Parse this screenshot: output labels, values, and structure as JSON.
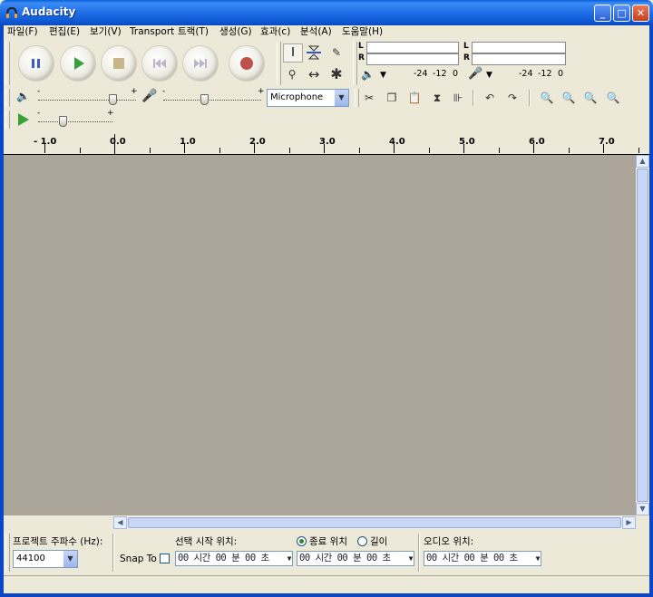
{
  "window": {
    "title": "Audacity"
  },
  "menu": [
    "파일(F)",
    "편집(E)",
    "보기(V)",
    "Transport",
    "트랙(T)",
    "생성(G)",
    "효과(c)",
    "분석(A)",
    "도움말(H)"
  ],
  "meters": {
    "left_channel": "L",
    "right_channel": "R",
    "scale_play": [
      "-24",
      "-12",
      "0"
    ],
    "scale_rec": [
      "-24",
      "-12",
      "0"
    ]
  },
  "mixer": {
    "input_source": "Microphone"
  },
  "ruler": {
    "labels": [
      "- 1.0",
      "0.0",
      "1.0",
      "2.0",
      "3.0",
      "4.0",
      "5.0",
      "6.0",
      "7.0"
    ]
  },
  "bottom": {
    "rate_label": "프로젝트 주파수 (Hz):",
    "rate_value": "44100",
    "snap_label": "Snap To",
    "selection_start_label": "선택 시작 위치:",
    "end_label": "종료 위치",
    "length_label": "길이",
    "audio_pos_label": "오디오 위치:",
    "time_start": "00 시간 00 분 00 초",
    "time_end": "00 시간 00 분 00 초",
    "time_audio": "00 시간 00 분 00 초"
  },
  "colors": {
    "track_area": "#aba699",
    "titlebar": "#0a5fdc",
    "record": "#c0504d",
    "play": "#3aa03a"
  }
}
